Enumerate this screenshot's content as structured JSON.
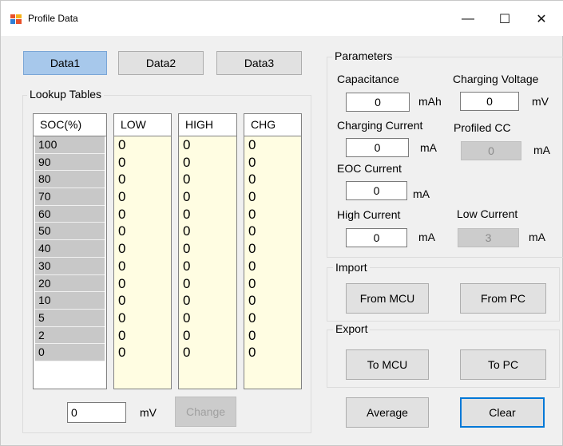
{
  "window": {
    "title": "Profile Data",
    "minimize_glyph": "—",
    "maximize_glyph": "☐",
    "close_glyph": "✕"
  },
  "data_tabs": [
    "Data1",
    "Data2",
    "Data3"
  ],
  "lookup": {
    "title": "Lookup Tables",
    "soc_header": "SOC(%)",
    "low_header": "LOW",
    "high_header": "HIGH",
    "chg_header": "CHG",
    "soc_values": [
      "100",
      "90",
      "80",
      "70",
      "60",
      "50",
      "40",
      "30",
      "20",
      "10",
      "5",
      "2",
      "0"
    ],
    "low_values": [
      "0",
      "0",
      "0",
      "0",
      "0",
      "0",
      "0",
      "0",
      "0",
      "0",
      "0",
      "0",
      "0"
    ],
    "high_values": [
      "0",
      "0",
      "0",
      "0",
      "0",
      "0",
      "0",
      "0",
      "0",
      "0",
      "0",
      "0",
      "0"
    ],
    "chg_values": [
      "0",
      "0",
      "0",
      "0",
      "0",
      "0",
      "0",
      "0",
      "0",
      "0",
      "0",
      "0",
      "0"
    ],
    "mv_value": "0",
    "mv_unit": "mV",
    "change_label": "Change"
  },
  "parameters": {
    "title": "Parameters",
    "capacitance_label": "Capacitance",
    "capacitance_value": "0",
    "capacitance_unit": "mAh",
    "charging_voltage_label": "Charging Voltage",
    "charging_voltage_value": "0",
    "charging_voltage_unit": "mV",
    "charging_current_label": "Charging Current",
    "charging_current_value": "0",
    "charging_current_unit": "mA",
    "profiled_cc_label": "Profiled CC",
    "profiled_cc_value": "0",
    "profiled_cc_unit": "mA",
    "eoc_current_label": "EOC Current",
    "eoc_current_value": "0",
    "eoc_current_unit": "mA",
    "high_current_label": "High Current",
    "high_current_value": "0",
    "high_current_unit": "mA",
    "low_current_label": "Low Current",
    "low_current_value": "3",
    "low_current_unit": "mA"
  },
  "import": {
    "title": "Import",
    "from_mcu": "From MCU",
    "from_pc": "From PC"
  },
  "export": {
    "title": "Export",
    "to_mcu": "To MCU",
    "to_pc": "To PC"
  },
  "bottom": {
    "average": "Average",
    "clear": "Clear"
  }
}
